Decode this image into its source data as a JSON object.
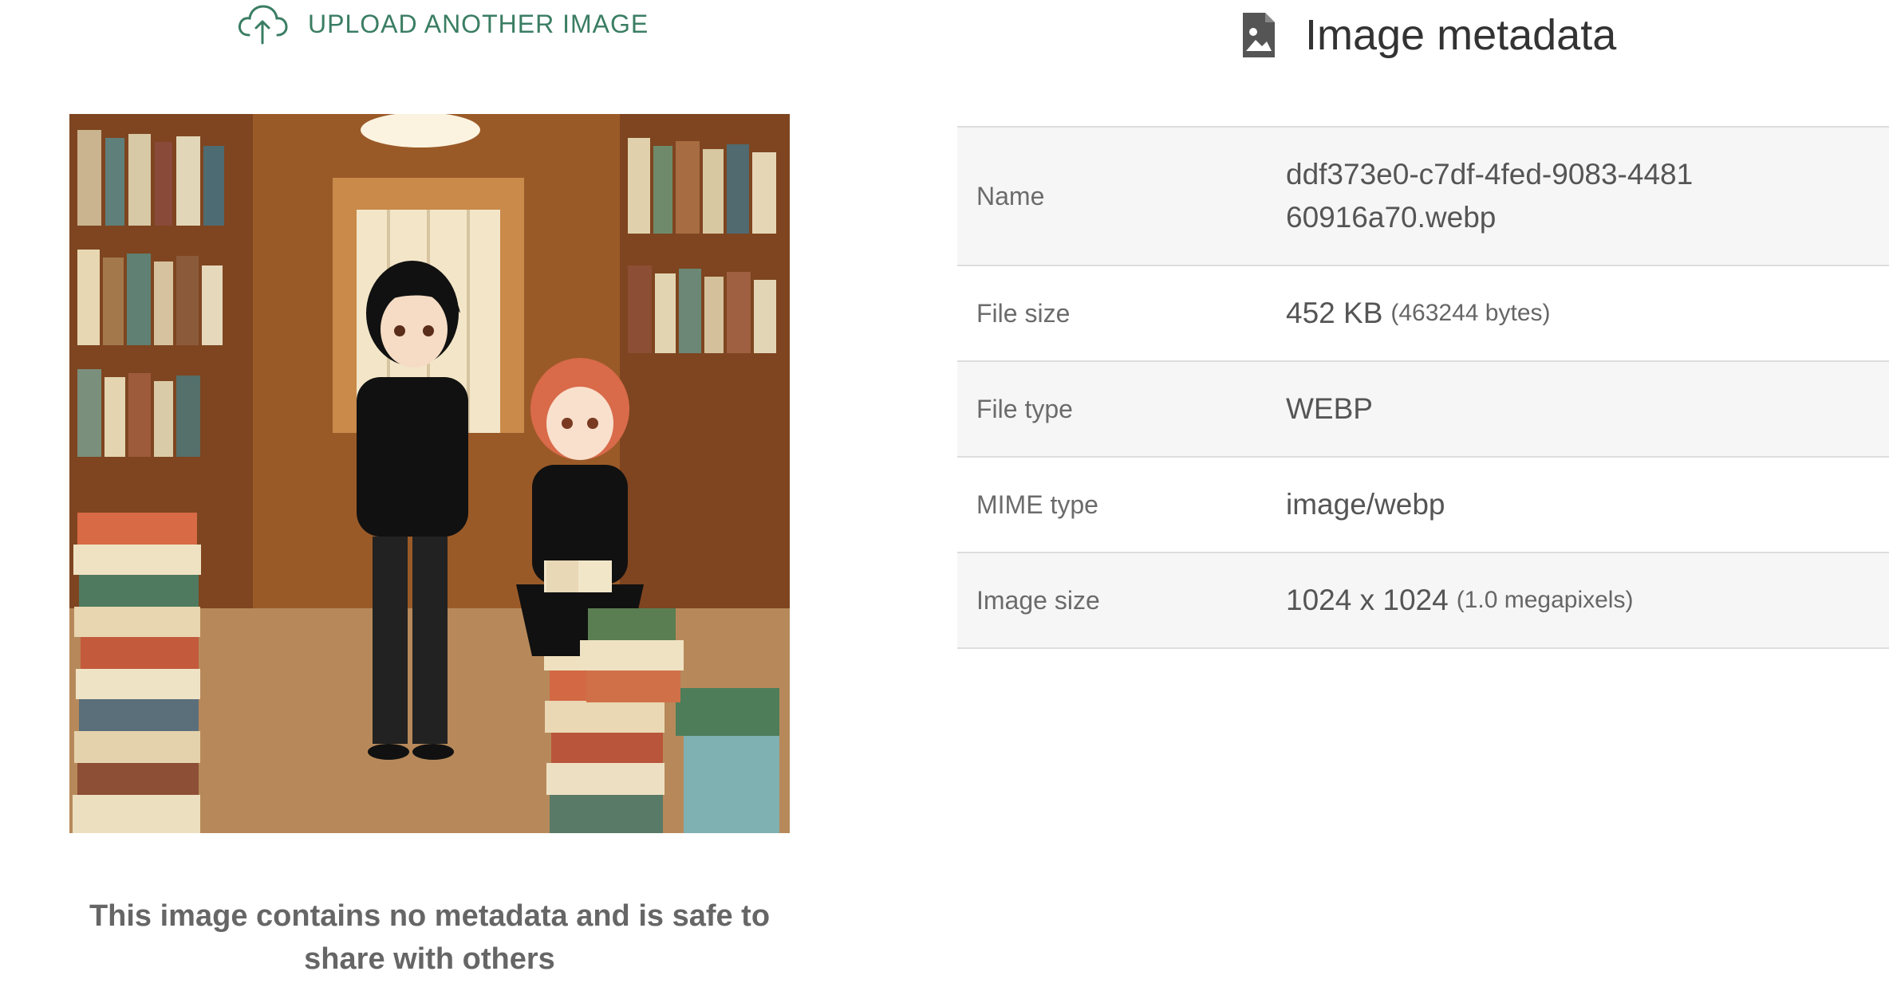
{
  "upload": {
    "label": "UPLOAD ANOTHER IMAGE",
    "icon": "cloud-upload-icon",
    "color": "#3a7d63"
  },
  "preview": {
    "alt": "Anime illustration of two kids standing in a cluttered bookstore"
  },
  "safe_message": "This image contains no metadata and is safe to share with others",
  "metadata": {
    "title": "Image metadata",
    "icon": "image-file-icon",
    "rows": [
      {
        "key": "Name",
        "value": "ddf373e0-c7df-4fed-9083-448160916a70.webp",
        "sub": ""
      },
      {
        "key": "File size",
        "value": "452 KB",
        "sub": "(463244 bytes)"
      },
      {
        "key": "File type",
        "value": "WEBP",
        "sub": ""
      },
      {
        "key": "MIME type",
        "value": "image/webp",
        "sub": ""
      },
      {
        "key": "Image size",
        "value": "1024 x 1024",
        "sub": "(1.0 megapixels)"
      }
    ]
  }
}
